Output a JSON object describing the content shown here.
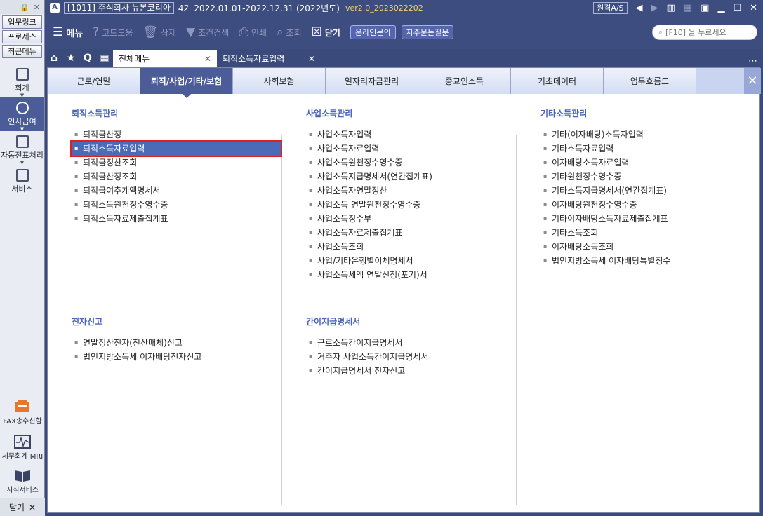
{
  "sidebar": {
    "links": [
      "업무링크",
      "프로세스",
      "최근메뉴"
    ],
    "items": [
      {
        "label": "회계",
        "icon": "calculator-icon"
      },
      {
        "label": "인사급여",
        "icon": "person-coin-icon"
      },
      {
        "label": "자동전표처리",
        "icon": "database-icon"
      },
      {
        "label": "서비스",
        "icon": "monitor-icon"
      }
    ],
    "bottom": [
      {
        "label": "FAX송수신함",
        "icon": "fax-icon"
      },
      {
        "label": "세무회계 MRI",
        "icon": "pulse-icon"
      },
      {
        "label": "지식서비스",
        "icon": "book-icon"
      }
    ],
    "close_label": "닫기"
  },
  "titlebar": {
    "company": "[1011] 주식회사 뉴본코리아",
    "period": "4기 2022.01.01-2022.12.31 (2022년도)",
    "version": "ver2.0_2023022202",
    "remote": "원격A/S"
  },
  "toolbar": {
    "menu": "메뉴",
    "code_help": "코드도움",
    "delete": "삭제",
    "filter": "조건검색",
    "print": "인쇄",
    "lookup": "조회",
    "close": "닫기",
    "online_inquiry": "온라인문의",
    "faq": "자주묻는질문",
    "search_placeholder": "[F10] 을 누르세요"
  },
  "tabs": {
    "all_menu": "전체메뉴",
    "current": "퇴직소득자료입력"
  },
  "categories": [
    "근로/연말",
    "퇴직/사업/기타/보험",
    "사회보험",
    "일자리자금관리",
    "종교인소득",
    "기초데이터",
    "업무흐름도"
  ],
  "sections": {
    "retire": {
      "title": "퇴직소득관리",
      "items": [
        "퇴직금산정",
        "퇴직소득자료입력",
        "퇴직금정산조회",
        "퇴직금산정조회",
        "퇴직급여추계액명세서",
        "퇴직소득원천징수영수증",
        "퇴직소득자료제출집계표"
      ]
    },
    "business": {
      "title": "사업소득관리",
      "items": [
        "사업소득자입력",
        "사업소득자료입력",
        "사업소득원천징수영수증",
        "사업소득지급명세서(연간집계표)",
        "사업소득자연말정산",
        "사업소득 연말원천징수영수증",
        "사업소득징수부",
        "사업소득자료제출집계표",
        "사업소득조회",
        "사업/기타은행별이체명세서",
        "사업소득세액 연말신청(포기)서"
      ]
    },
    "other": {
      "title": "기타소득관리",
      "items": [
        "기타(이자배당)소득자입력",
        "기타소득자료입력",
        "이자배당소득자료입력",
        "기타원천징수영수증",
        "기타소득지급명세서(연간집계표)",
        "이자배당원천징수영수증",
        "기타이자배당소득자료제출집계표",
        "기타소득조회",
        "이자배당소득조회",
        "법인지방소득세 이자배당특별징수"
      ]
    },
    "efile": {
      "title": "전자신고",
      "items": [
        "연말정산전자(전산매체)신고",
        "법인지방소득세 이자배당전자신고"
      ]
    },
    "simple": {
      "title": "간이지급명세서",
      "items": [
        "근로소득간이지급명세서",
        "거주자 사업소득간이지급명세서",
        "간이지급명세서 전자신고"
      ]
    }
  }
}
